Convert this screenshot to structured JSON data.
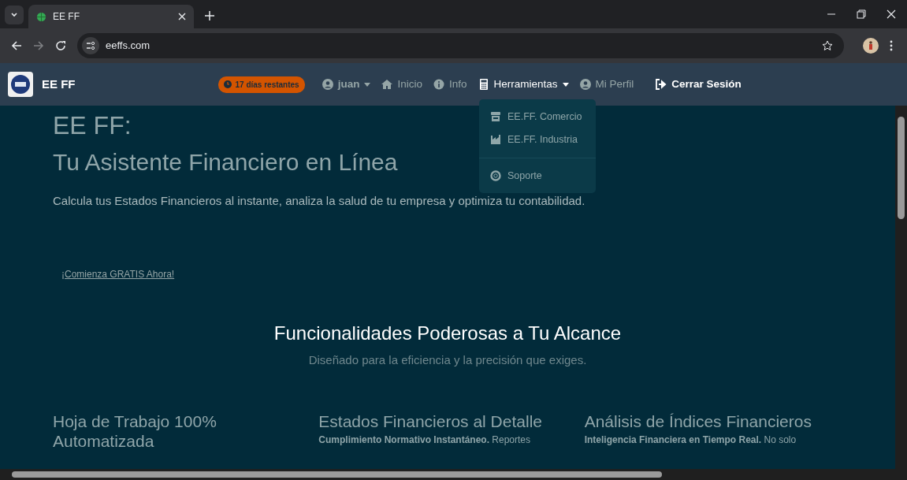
{
  "browser": {
    "tab_title": "EE FF",
    "url": "eeffs.com"
  },
  "navbar": {
    "brand": "EE FF",
    "trial_badge": "17 días restantes",
    "user": "juan",
    "links": [
      {
        "label": "Inicio",
        "kind": "link"
      },
      {
        "label": "Info",
        "kind": "link"
      },
      {
        "label": "Herramientas",
        "kind": "dropdown",
        "expanded": true
      },
      {
        "label": "Mi Perfil",
        "kind": "link"
      },
      {
        "label": "Cerrar Sesión",
        "kind": "logout"
      }
    ],
    "dropdown": [
      {
        "label": "EE.FF. Comercio",
        "kind": "item"
      },
      {
        "label": "EE.FF. Industria",
        "kind": "item"
      },
      {
        "kind": "divider"
      },
      {
        "label": "Soporte",
        "kind": "item"
      }
    ]
  },
  "hero": {
    "title": "EE FF:",
    "subtitle": "Tu Asistente Financiero en Línea",
    "lead": "Calcula tus Estados Financieros al instante, analiza la salud de tu empresa y optimiza tu contabilidad.",
    "cta": "¡Comienza GRATIS Ahora!"
  },
  "features": {
    "heading": "Funcionalidades Poderosas a Tu Alcance",
    "subheading": "Diseñado para la eficiencia y la precisión que exiges.",
    "cards": [
      {
        "title": "Hoja de Trabajo 100% Automatizada"
      },
      {
        "title": "Estados Financieros al Detalle",
        "text": "**Cumplimiento Normativo Instantáneo.** Reportes"
      },
      {
        "title": "Análisis de Índices Financieros",
        "text": "**Inteligencia Financiera en Tiempo Real.** No solo"
      }
    ]
  }
}
